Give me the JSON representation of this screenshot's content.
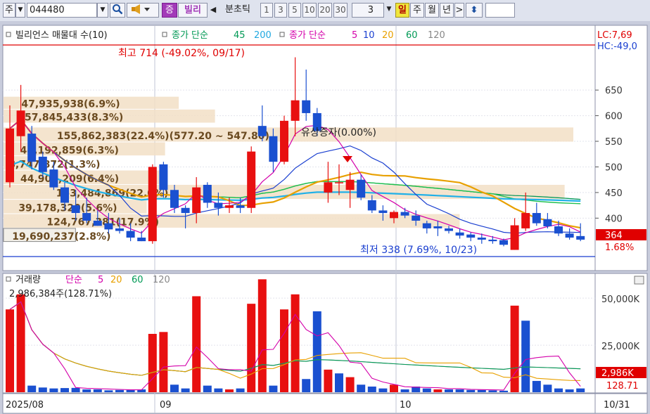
{
  "toolbar": {
    "market": "주",
    "code": "044480",
    "search_icon": "magnifier-icon",
    "sound_icon": "speaker-icon",
    "flag": "증",
    "name": "빌리",
    "prev_icon": "◀",
    "period_label": "분초틱",
    "periods": [
      "1",
      "3",
      "5",
      "10",
      "20",
      "30"
    ],
    "count": "3",
    "units": [
      "일",
      "주",
      "월",
      "년"
    ],
    "next_icon": ">",
    "sort_icon": "⬍"
  },
  "chart_data": [
    {
      "type": "candlestick",
      "title": "빌리언스 매물대 수(10)",
      "legend": [
        {
          "label": "종가 단순",
          "values": [
            "45",
            "200"
          ]
        },
        {
          "label": "종가 단순",
          "values": [
            "5",
            "10",
            "20",
            "60",
            "120"
          ]
        }
      ],
      "yticks": [
        650,
        600,
        550,
        500,
        450,
        400
      ],
      "ylim": [
        325,
        738
      ],
      "lc": "LC:7,69",
      "hc": "HC:-49,0",
      "max_label": "최고 714 (-49.02%, 09/17)",
      "min_label": "최저 338 (7.69%, 10/23)",
      "event_label": "유상증자(0.00%)",
      "current_price": "364",
      "current_pct": "1.68%",
      "volume_profile": [
        {
          "label": "47,935,938(6.9%)",
          "low": 612,
          "high": 637
        },
        {
          "label": "57,845,433(8.3%)",
          "low": 585,
          "high": 612
        },
        {
          "label": "155,862,383(22.4%)(577.20 ~ 547.80)",
          "low": 548,
          "high": 577
        },
        {
          "label": "44,192,859(6.3%)",
          "low": 521,
          "high": 548
        },
        {
          "label": "8,747,872(1.3%)",
          "low": 493,
          "high": 521
        },
        {
          "label": "44,904,209(6.4%)",
          "low": 465,
          "high": 493
        },
        {
          "label": "153,484,869(22.0%)",
          "low": 436,
          "high": 465
        },
        {
          "label": "39,178,320(5.6%)",
          "low": 408,
          "high": 436
        },
        {
          "label": "124,767,381(17.9%)",
          "low": 380,
          "high": 408
        },
        {
          "label": "19,690,237(2.8%)",
          "low": 353,
          "high": 380
        }
      ],
      "candles": [
        {
          "o": 470,
          "h": 620,
          "l": 460,
          "c": 575
        },
        {
          "o": 560,
          "h": 660,
          "l": 530,
          "c": 610
        },
        {
          "o": 565,
          "h": 580,
          "l": 495,
          "c": 510
        },
        {
          "o": 520,
          "h": 530,
          "l": 480,
          "c": 490
        },
        {
          "o": 495,
          "h": 510,
          "l": 455,
          "c": 460
        },
        {
          "o": 460,
          "h": 470,
          "l": 415,
          "c": 430
        },
        {
          "o": 425,
          "h": 455,
          "l": 395,
          "c": 410
        },
        {
          "o": 410,
          "h": 440,
          "l": 390,
          "c": 395
        },
        {
          "o": 395,
          "h": 415,
          "l": 385,
          "c": 385
        },
        {
          "o": 390,
          "h": 410,
          "l": 370,
          "c": 378
        },
        {
          "o": 380,
          "h": 400,
          "l": 370,
          "c": 375
        },
        {
          "o": 375,
          "h": 390,
          "l": 355,
          "c": 362
        },
        {
          "o": 362,
          "h": 375,
          "l": 355,
          "c": 355
        },
        {
          "o": 355,
          "h": 505,
          "l": 350,
          "c": 500
        },
        {
          "o": 505,
          "h": 510,
          "l": 440,
          "c": 455
        },
        {
          "o": 455,
          "h": 465,
          "l": 410,
          "c": 420
        },
        {
          "o": 420,
          "h": 425,
          "l": 380,
          "c": 410
        },
        {
          "o": 410,
          "h": 480,
          "l": 390,
          "c": 460
        },
        {
          "o": 465,
          "h": 470,
          "l": 420,
          "c": 430
        },
        {
          "o": 430,
          "h": 450,
          "l": 405,
          "c": 420
        },
        {
          "o": 420,
          "h": 440,
          "l": 410,
          "c": 425
        },
        {
          "o": 425,
          "h": 440,
          "l": 410,
          "c": 420
        },
        {
          "o": 420,
          "h": 540,
          "l": 410,
          "c": 530
        },
        {
          "o": 580,
          "h": 620,
          "l": 550,
          "c": 560
        },
        {
          "o": 560,
          "h": 575,
          "l": 490,
          "c": 510
        },
        {
          "o": 510,
          "h": 600,
          "l": 505,
          "c": 590
        },
        {
          "o": 590,
          "h": 714,
          "l": 560,
          "c": 630
        },
        {
          "o": 630,
          "h": 690,
          "l": 590,
          "c": 605
        },
        {
          "o": 605,
          "h": 615,
          "l": 560,
          "c": 570
        },
        {
          "o": 450,
          "h": 510,
          "l": 430,
          "c": 470
        },
        {
          "o": 470,
          "h": 505,
          "l": 445,
          "c": 470
        },
        {
          "o": 455,
          "h": 490,
          "l": 420,
          "c": 475
        },
        {
          "o": 475,
          "h": 485,
          "l": 435,
          "c": 440
        },
        {
          "o": 435,
          "h": 445,
          "l": 410,
          "c": 415
        },
        {
          "o": 415,
          "h": 425,
          "l": 395,
          "c": 410
        },
        {
          "o": 400,
          "h": 415,
          "l": 390,
          "c": 412
        },
        {
          "o": 412,
          "h": 420,
          "l": 400,
          "c": 405
        },
        {
          "o": 405,
          "h": 415,
          "l": 385,
          "c": 395
        },
        {
          "o": 390,
          "h": 395,
          "l": 370,
          "c": 380
        },
        {
          "o": 384,
          "h": 395,
          "l": 365,
          "c": 380
        },
        {
          "o": 380,
          "h": 385,
          "l": 370,
          "c": 375
        },
        {
          "o": 372,
          "h": 380,
          "l": 360,
          "c": 366
        },
        {
          "o": 368,
          "h": 372,
          "l": 355,
          "c": 362
        },
        {
          "o": 362,
          "h": 370,
          "l": 350,
          "c": 358
        },
        {
          "o": 358,
          "h": 365,
          "l": 350,
          "c": 355
        },
        {
          "o": 357,
          "h": 360,
          "l": 345,
          "c": 348
        },
        {
          "o": 338,
          "h": 400,
          "l": 338,
          "c": 386
        },
        {
          "o": 380,
          "h": 450,
          "l": 375,
          "c": 410
        },
        {
          "o": 410,
          "h": 430,
          "l": 385,
          "c": 390
        },
        {
          "o": 398,
          "h": 410,
          "l": 380,
          "c": 384
        },
        {
          "o": 384,
          "h": 395,
          "l": 365,
          "c": 370
        },
        {
          "o": 370,
          "h": 380,
          "l": 358,
          "c": 362
        },
        {
          "o": 365,
          "h": 390,
          "l": 355,
          "c": 358
        }
      ],
      "x_dates": [
        "2025/08",
        "09",
        "10",
        "10/31"
      ]
    },
    {
      "type": "bar",
      "title": "거래량",
      "legend_label": "단순",
      "legend_values": [
        "5",
        "20",
        "60",
        "120"
      ],
      "info": "2,986,384주(128.71%)",
      "yticks": [
        "50,000K",
        "25,000K"
      ],
      "ylim": [
        0,
        62000
      ],
      "last_value": "2,986K",
      "last_pct": "128.71",
      "values": [
        44000,
        52000,
        3500,
        2500,
        2000,
        2200,
        2300,
        1500,
        1500,
        1000,
        1200,
        1200,
        1500,
        31000,
        32000,
        4000,
        2000,
        51000,
        3500,
        2000,
        1500,
        2000,
        47000,
        60000,
        3500,
        44000,
        52000,
        7000,
        43000,
        12000,
        10000,
        8000,
        4000,
        3000,
        2000,
        4000,
        1500,
        3000,
        2000,
        1500,
        1500,
        1500,
        1200,
        1200,
        1000,
        800,
        46000,
        38000,
        6000,
        4000,
        2000,
        1500,
        2000
      ],
      "up": [
        true,
        true,
        false,
        false,
        false,
        false,
        false,
        false,
        false,
        false,
        false,
        false,
        false,
        true,
        true,
        false,
        false,
        true,
        false,
        false,
        true,
        false,
        true,
        true,
        false,
        true,
        true,
        false,
        false,
        true,
        false,
        true,
        false,
        false,
        false,
        true,
        false,
        false,
        false,
        true,
        false,
        false,
        false,
        false,
        false,
        false,
        true,
        false,
        false,
        false,
        false,
        false,
        false
      ]
    }
  ]
}
